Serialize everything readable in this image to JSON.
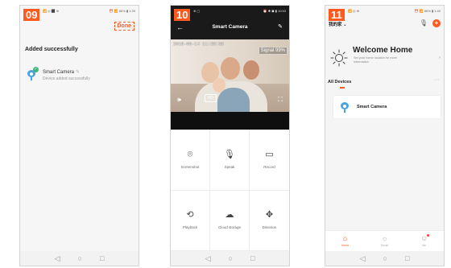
{
  "colors": {
    "accent": "#ff5a1f",
    "camera_icon": "#4aa3df",
    "success": "#3cb878"
  },
  "phone1": {
    "step": "09",
    "status": {
      "left": "📶 ◎ ⬛ ⊕",
      "right": "⏰ 📶 86% ▮ 1:39"
    },
    "done_label": "Done",
    "title": "Added successfully",
    "device_name": "Smart Camera",
    "device_status": "Device added successfully"
  },
  "phone2": {
    "step": "10",
    "status": {
      "left": "⊕ ▢",
      "right": "⏰ ✱ ◼ ▮ 10:53"
    },
    "title": "Smart Camera",
    "timestamp": "2018-05-14 11:28:38",
    "signal": "Signal 99%",
    "hd_label": "HD",
    "controls": [
      {
        "label": "Screenshot",
        "icon": "⌾"
      },
      {
        "label": "Speak",
        "icon": "🎙"
      },
      {
        "label": "Record",
        "icon": "▭"
      },
      {
        "label": "Playback",
        "icon": "⟲"
      },
      {
        "label": "Cloud storage",
        "icon": "☁"
      },
      {
        "label": "Direction",
        "icon": "✥"
      }
    ]
  },
  "phone3": {
    "step": "11",
    "status": {
      "left": "📶 ◎ ⊕",
      "right": "⏰ 📶 86% ▮ 1:40"
    },
    "home_name": "我的家 ⌄",
    "welcome": "Welcome Home",
    "location_hint": "Set your home location for more information",
    "all_devices": "All Devices",
    "device_name": "Smart Camera",
    "tabs": [
      {
        "label": "Home",
        "icon": "⌂",
        "active": true
      },
      {
        "label": "Smart",
        "icon": "☼",
        "active": false
      },
      {
        "label": "Me",
        "icon": "☺",
        "active": false
      }
    ]
  },
  "navbar": {
    "back": "◁",
    "home": "○",
    "recents": "□"
  }
}
